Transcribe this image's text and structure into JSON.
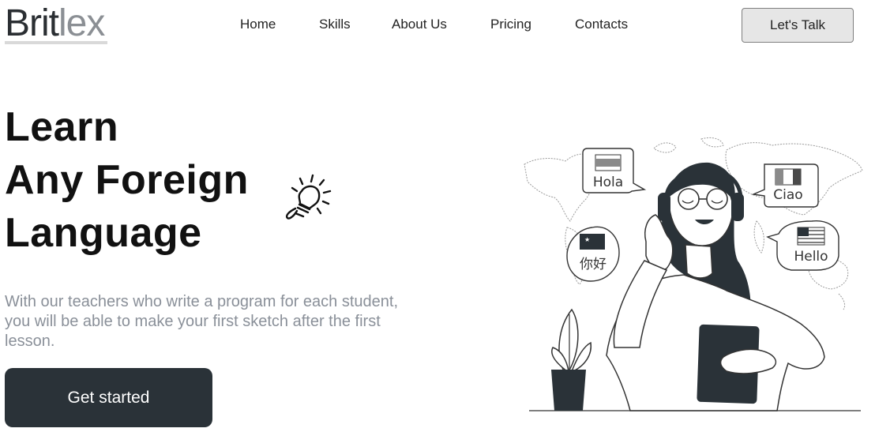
{
  "brand": {
    "logo_part1": "Brit",
    "logo_part2": "lex"
  },
  "nav": {
    "items": [
      {
        "label": "Home"
      },
      {
        "label": "Skills"
      },
      {
        "label": "About Us"
      },
      {
        "label": "Pricing"
      },
      {
        "label": "Contacts"
      }
    ],
    "cta_label": "Let's Talk"
  },
  "hero": {
    "headline_line1": "Learn",
    "headline_line2": "Any Foreign",
    "headline_line3": "Language",
    "subtext": "With our teachers who write a program for each student, you will be able to make your first sketch after the first lesson.",
    "cta_label": "Get started"
  },
  "illustration": {
    "bubbles": [
      {
        "text": "Hola"
      },
      {
        "text": "Ciao"
      },
      {
        "text": "你好"
      },
      {
        "text": "Hello"
      }
    ]
  },
  "colors": {
    "cta_bg": "#2a3238",
    "text_muted": "#8a9099",
    "talk_btn_bg": "#e6e6e6"
  }
}
